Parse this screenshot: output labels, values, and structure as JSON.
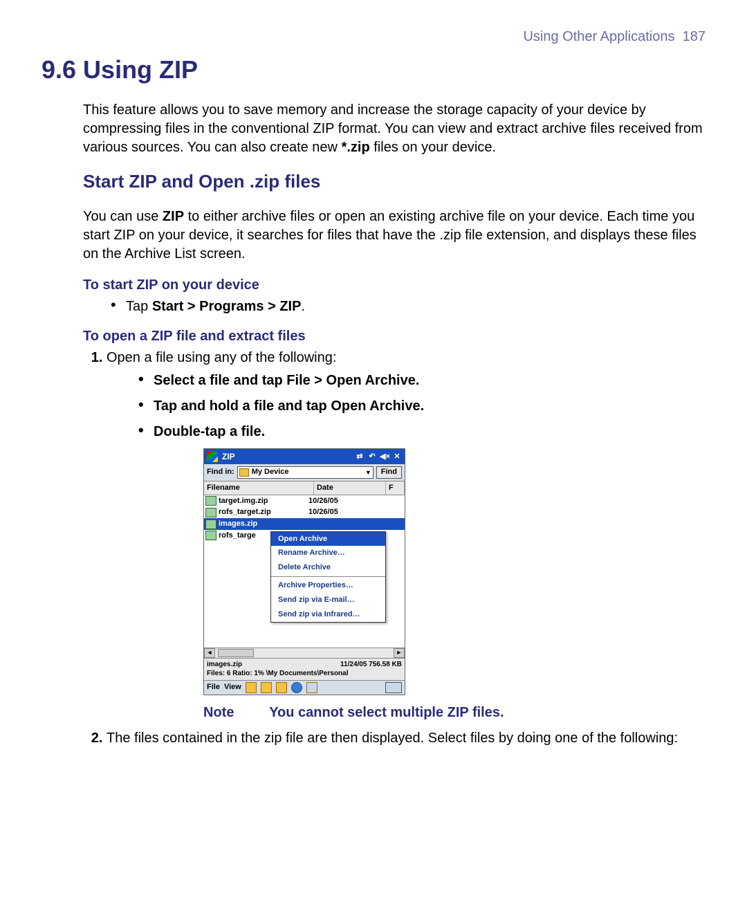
{
  "header": {
    "chapter": "Using Other Applications",
    "page": "187"
  },
  "title": "9.6 Using ZIP",
  "intro_pre": "This feature allows you to save memory and increase the storage capacity of your device by compressing files in the conventional ZIP format. You can view and extract archive files received from various sources. You can also create new ",
  "intro_bold": "*.zip",
  "intro_post": " files on your device.",
  "subsection": "Start ZIP and Open .zip files",
  "sub_intro_pre": "You can use ",
  "sub_intro_bold": "ZIP",
  "sub_intro_post": " to either archive files or open an existing archive file on your device. Each time you start ZIP on your device, it searches for files that have the .zip file extension, and displays these files on the Archive List screen.",
  "task1": "To start ZIP on your device",
  "task1_b1_pre": "Tap ",
  "task1_b1_bold": "Start > Programs > ZIP",
  "task1_b1_post": ".",
  "task2": "To open a ZIP file and extract files",
  "step1": "Open a file using any of the following:",
  "step1_b1_pre": "Select a file and tap ",
  "step1_b1_bold": "File > Open Archive",
  "step1_b1_post": ".",
  "step1_b2_pre": "Tap and hold a file and tap ",
  "step1_b2_bold": "Open Archive",
  "step1_b2_post": ".",
  "step1_b3": "Double-tap a file.",
  "note_label": "Note",
  "note_text": "You cannot select multiple ZIP files.",
  "step2": "The files contained in the zip file are then displayed. Select files by doing one of the following:",
  "screenshot": {
    "app_title": "ZIP",
    "find_label": "Find in:",
    "find_location": "My Device",
    "find_button": "Find",
    "columns": {
      "name": "Filename",
      "date": "Date",
      "r": "F"
    },
    "files": [
      {
        "name": "target.img.zip",
        "date": "10/26/05"
      },
      {
        "name": "rofs_target.zip",
        "date": "10/26/05"
      },
      {
        "name": "images.zip",
        "date": ""
      },
      {
        "name": "rofs_targe",
        "date": ""
      }
    ],
    "menu": {
      "items": [
        "Open Archive",
        "Rename Archive…",
        "Delete Archive",
        "Archive Properties…",
        "Send zip via E-mail…",
        "Send zip via Infrared…"
      ]
    },
    "status_file": "images.zip",
    "status_right": "11/24/05 756.58 KB",
    "status_line2": "Files: 6  Ratio: 1%  \\My Documents\\Personal",
    "menu_file": "File",
    "menu_view": "View"
  }
}
